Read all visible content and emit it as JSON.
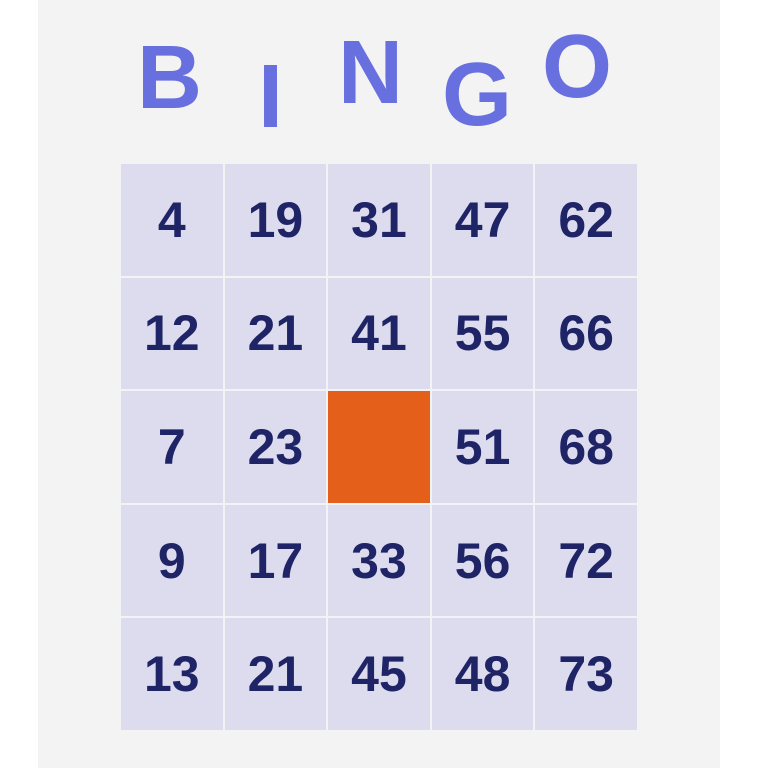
{
  "header": {
    "letters": [
      "B",
      "I",
      "N",
      "G",
      "O"
    ]
  },
  "grid": {
    "rows": [
      [
        "4",
        "19",
        "31",
        "47",
        "62"
      ],
      [
        "12",
        "21",
        "41",
        "55",
        "66"
      ],
      [
        "7",
        "23",
        "",
        "51",
        "68"
      ],
      [
        "9",
        "17",
        "33",
        "56",
        "72"
      ],
      [
        "13",
        "21",
        "45",
        "48",
        "73"
      ]
    ],
    "free_cell_color": "#e4601a"
  },
  "colors": {
    "header_letters": "#6870e0",
    "cell_background": "#dcdcee",
    "number_text": "#1f2466",
    "card_background": "#f3f3f4"
  }
}
